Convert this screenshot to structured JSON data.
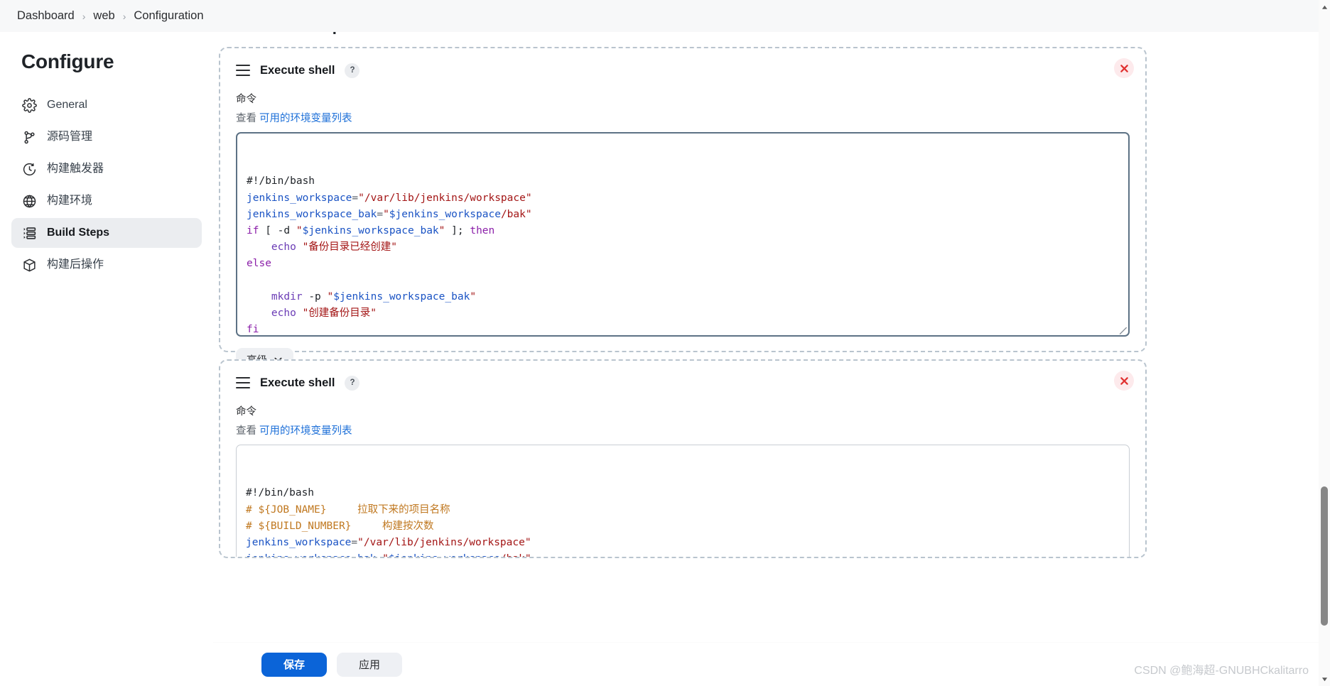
{
  "breadcrumb": {
    "items": [
      {
        "label": "Dashboard"
      },
      {
        "label": "web"
      },
      {
        "label": "Configuration"
      }
    ],
    "separator": "›"
  },
  "sidebar": {
    "title": "Configure",
    "items": [
      {
        "label": "General",
        "icon": "gear-icon",
        "active": false
      },
      {
        "label": "源码管理",
        "icon": "branch-icon",
        "active": false
      },
      {
        "label": "构建触发器",
        "icon": "clock-icon",
        "active": false
      },
      {
        "label": "构建环境",
        "icon": "globe-icon",
        "active": false
      },
      {
        "label": "Build Steps",
        "icon": "list-icon",
        "active": true
      },
      {
        "label": "构建后操作",
        "icon": "box-icon",
        "active": false
      }
    ]
  },
  "main": {
    "section_title": "Build Steps"
  },
  "steps": [
    {
      "title": "Execute shell",
      "help_label": "?",
      "command_label": "命令",
      "env_prefix": "查看",
      "env_link": "可用的环境变量列表",
      "advanced_label": "高级",
      "close_label": "×",
      "script": "#!/bin/bash\njenkins_workspace=\"/var/lib/jenkins/workspace\"\njenkins_workspace_bak=\"$jenkins_workspace/bak\"\nif [ -d \"$jenkins_workspace_bak\" ]; then\n    echo \"备份目录已经创建\"\nelse\n\n    mkdir -p \"$jenkins_workspace_bak\"\n    echo \"创建备份目录\"\nfi"
    },
    {
      "title": "Execute shell",
      "help_label": "?",
      "command_label": "命令",
      "env_prefix": "查看",
      "env_link": "可用的环境变量列表",
      "close_label": "×",
      "script": "#!/bin/bash\n# ${JOB_NAME}     拉取下来的项目名称\n# ${BUILD_NUMBER}     构建按次数\njenkins_workspace=\"/var/lib/jenkins/workspace\"\njenkins_workspace_bak=\"$jenkins_workspace/bak\"\ncase $status in\nfabu)\ncd ${jenkins_workspace}/${JOB_NAME}"
    }
  ],
  "footer": {
    "save_label": "保存",
    "apply_label": "应用"
  },
  "watermark": {
    "text": "CSDN @鲍海超-GNUBHCkalitarro"
  },
  "colors": {
    "accent": "#0b64d8",
    "link": "#1c6fd8",
    "danger": "#e03030",
    "panel_border": "#b9c4ce",
    "active_bg": "#ebedf0"
  }
}
